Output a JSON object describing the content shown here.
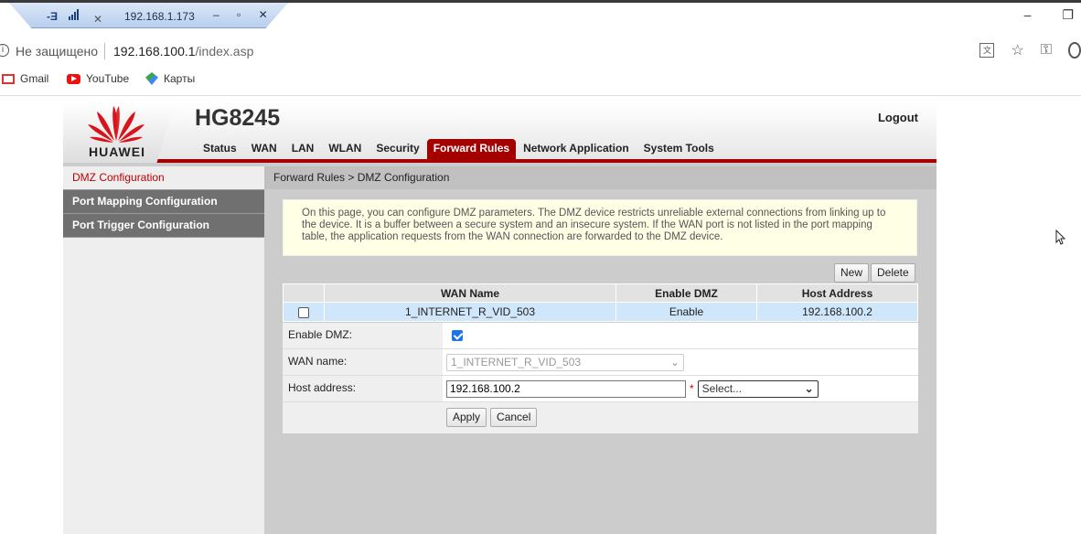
{
  "remote_session": {
    "host": "192.168.1.173",
    "pin_label": "-Ǝ"
  },
  "window": {
    "minimize": "–",
    "restore": "❐"
  },
  "address_bar": {
    "security_label": "Не защищено",
    "url_host": "192.168.100.1",
    "url_path": "/index.asp"
  },
  "bookmarks": [
    {
      "label": "Gmail",
      "icon": "gmail-icon"
    },
    {
      "label": "YouTube",
      "icon": "youtube-icon"
    },
    {
      "label": "Карты",
      "icon": "maps-icon"
    }
  ],
  "header": {
    "brand": "HUAWEI",
    "model": "HG8245",
    "logout": "Logout",
    "nav": [
      "Status",
      "WAN",
      "LAN",
      "WLAN",
      "Security",
      "Forward Rules",
      "Network Application",
      "System Tools"
    ],
    "active_nav": "Forward Rules"
  },
  "sidebar": {
    "items": [
      {
        "label": "DMZ Configuration",
        "active": true
      },
      {
        "label": "Port Mapping Configuration",
        "active": false
      },
      {
        "label": "Port Trigger Configuration",
        "active": false
      }
    ]
  },
  "main": {
    "breadcrumb": "Forward Rules > DMZ Configuration",
    "info": "On this page, you can configure DMZ parameters. The DMZ device restricts unreliable external connections from linking up to the device. It is a buffer between a secure system and an insecure system. If the WAN port is not listed in the port mapping table, the application requests from the WAN connection are forwarded to the DMZ device.",
    "buttons": {
      "new": "New",
      "delete": "Delete"
    },
    "table": {
      "headers": [
        "",
        "WAN Name",
        "Enable DMZ",
        "Host Address"
      ],
      "rows": [
        {
          "wan_name": "1_INTERNET_R_VID_503",
          "enable_dmz": "Enable",
          "host_address": "192.168.100.2"
        }
      ]
    },
    "form": {
      "enable_label": "Enable DMZ:",
      "enable_checked": true,
      "wan_label": "WAN name:",
      "wan_value": "1_INTERNET_R_VID_503",
      "host_label": "Host address:",
      "host_value": "192.168.100.2",
      "required_mark": "*",
      "host_select": "Select...",
      "apply": "Apply",
      "cancel": "Cancel"
    }
  },
  "colors": {
    "brand_red": "#a40000",
    "sidebar_gray": "#707070",
    "row_highlight": "#cfe6fb",
    "info_bg": "#ffffe6"
  }
}
